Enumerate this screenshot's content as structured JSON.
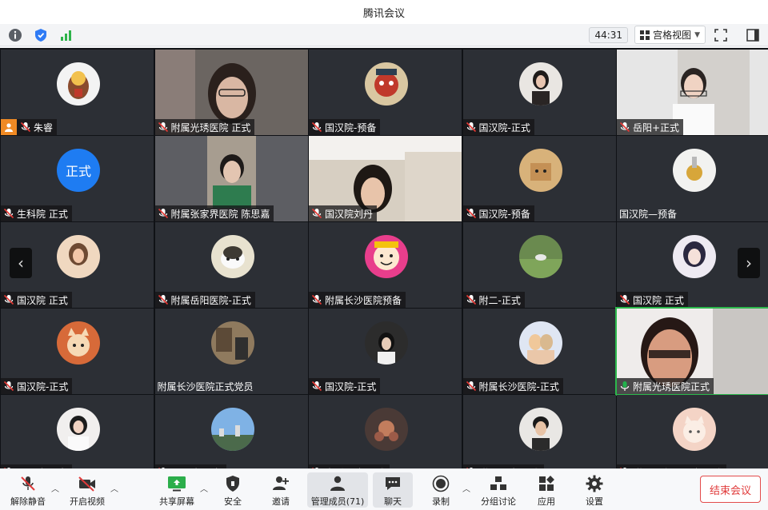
{
  "window": {
    "title": "腾讯会议"
  },
  "status": {
    "timer": "44:31",
    "layout_label": "宫格视图"
  },
  "colors": {
    "host_badge": "#f08a24",
    "speaking_mic": "#22b24c",
    "end_button": "#e34b4b",
    "text_avatar": "#1e7cf2"
  },
  "participants": [
    {
      "name": "朱睿",
      "host": true,
      "mic": "muted",
      "avatar": "mascot"
    },
    {
      "name": "附属光琇医院   正式",
      "mic": "muted",
      "avatar": "video"
    },
    {
      "name": "国汉院-预备",
      "mic": "muted",
      "avatar": "opera-mask"
    },
    {
      "name": "国汉院-正式",
      "mic": "muted",
      "avatar": "girl-photo"
    },
    {
      "name": "岳阳+正式",
      "mic": "muted",
      "avatar": "video"
    },
    {
      "name": "生科院 正式",
      "mic": "muted",
      "avatar": "text",
      "avatar_text": "正式"
    },
    {
      "name": "附属张家界医院 陈思嘉",
      "mic": "muted",
      "avatar": "video"
    },
    {
      "name": "国汉院刘丹",
      "mic": "muted",
      "avatar": "video"
    },
    {
      "name": "国汉院-预备",
      "mic": "muted",
      "avatar": "cartoon-box"
    },
    {
      "name": "国汉院—预备",
      "mic": "none",
      "avatar": "gold-object"
    },
    {
      "name": "国汉院 正式",
      "mic": "muted",
      "avatar": "girl-warm"
    },
    {
      "name": "附属岳阳医院-正式",
      "mic": "muted",
      "avatar": "cat"
    },
    {
      "name": "附属长沙医院预备",
      "mic": "muted",
      "avatar": "cartoon-face"
    },
    {
      "name": "附二-正式",
      "mic": "muted",
      "avatar": "outdoor"
    },
    {
      "name": "国汉院 正式",
      "mic": "muted",
      "avatar": "anime-girl"
    },
    {
      "name": "国汉院-正式",
      "mic": "muted",
      "avatar": "cartoon-cat"
    },
    {
      "name": "附属长沙医院正式党员",
      "mic": "none",
      "avatar": "room"
    },
    {
      "name": "国汉院-正式",
      "mic": "muted",
      "avatar": "girl-dark"
    },
    {
      "name": "附属长沙医院-正式",
      "mic": "muted",
      "avatar": "couple"
    },
    {
      "name": "附属光琇医院正式",
      "mic": "speaking",
      "avatar": "video"
    },
    {
      "name": "国汉院-预备",
      "mic": "muted",
      "avatar": "girl-white"
    },
    {
      "name": "国汉院-预备",
      "mic": "muted",
      "avatar": "city"
    },
    {
      "name": "光琇医院-正式",
      "mic": "muted",
      "avatar": "flower"
    },
    {
      "name": "附二医院-正式",
      "mic": "muted",
      "avatar": "boy"
    },
    {
      "name": "附属张家界医院-正式",
      "mic": "muted",
      "avatar": "cat-drawing"
    }
  ],
  "toolbar": {
    "unmute": "解除静音",
    "start_video": "开启视频",
    "share_screen": "共享屏幕",
    "security": "安全",
    "invite": "邀请",
    "members": "管理成员(71)",
    "chat": "聊天",
    "record": "录制",
    "breakout": "分组讨论",
    "apps": "应用",
    "settings": "设置",
    "end_meeting": "结束会议"
  }
}
